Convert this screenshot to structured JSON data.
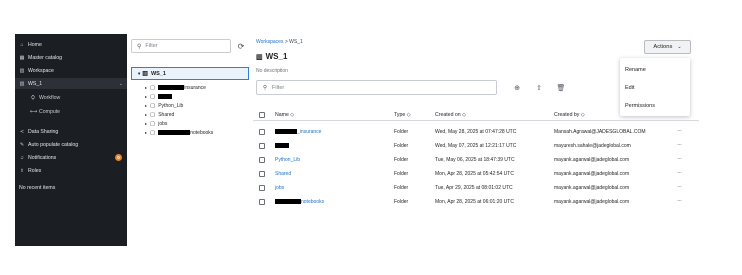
{
  "sidebar": {
    "items": [
      {
        "icon": "⌂",
        "icon_name": "home-icon",
        "label": "Home"
      },
      {
        "icon": "▦",
        "icon_name": "catalog-icon",
        "label": "Master catalog"
      },
      {
        "icon": "▥",
        "icon_name": "workspace-icon",
        "label": "Workspace"
      },
      {
        "icon": "▥",
        "icon_name": "workspace-icon",
        "label": "WS_1",
        "active": true
      },
      {
        "icon": "⛭",
        "icon_name": "workflow-icon",
        "label": "Workflow"
      },
      {
        "icon": "⟷",
        "icon_name": "compute-icon",
        "label": "Compute"
      },
      {
        "icon": "≺",
        "icon_name": "share-icon",
        "label": "Data Sharing"
      },
      {
        "icon": "✎",
        "icon_name": "auto-populate-icon",
        "label": "Auto populate catalog"
      },
      {
        "icon": "♫",
        "icon_name": "bell-icon",
        "label": "Notifications",
        "badge": "0"
      },
      {
        "icon": "♗",
        "icon_name": "roles-icon",
        "label": "Roles"
      }
    ],
    "recent_label": "No recent items"
  },
  "tree": {
    "search_placeholder": "Filter",
    "root_label": "WS_1",
    "children": [
      {
        "label": "insurance",
        "redacted": true
      },
      {
        "label": "",
        "redacted": true
      },
      {
        "label": "Python_Lib",
        "redacted": false
      },
      {
        "label": "Shared",
        "redacted": false
      },
      {
        "label": "jobs",
        "redacted": false
      },
      {
        "label": "notebooks",
        "redacted": true
      }
    ]
  },
  "main": {
    "breadcrumb": {
      "root": "Workspaces",
      "separator": ">",
      "current": "WS_1"
    },
    "title": "WS_1",
    "description": "No description",
    "actions_label": "Actions",
    "actions_menu": [
      "Rename",
      "Edit",
      "Permissions"
    ],
    "filter_placeholder": "Filter",
    "columns": {
      "name": "Name",
      "type": "Type",
      "created_on": "Created on",
      "created_by": "Created by"
    },
    "rows": [
      {
        "name": "_insurance",
        "redacted": true,
        "type": "Folder",
        "created_on": "Wed, May 28, 2025 at 07:47:28 UTC",
        "created_by": "Mansah.Agrawal@JADESGLOBAL.COM"
      },
      {
        "name": "",
        "redacted": true,
        "type": "Folder",
        "created_on": "Wed, May 07, 2025 at 12:21:17 UTC",
        "created_by": "mayuresh.sahale@jadeglobal.com"
      },
      {
        "name": "Python_Lib",
        "redacted": false,
        "type": "Folder",
        "created_on": "Tue, May 06, 2025 at 18:47:39 UTC",
        "created_by": "mayank.agarwal@jadeglobal.com"
      },
      {
        "name": "Shared",
        "redacted": false,
        "type": "Folder",
        "created_on": "Mon, Apr 28, 2025 at 05:42:54 UTC",
        "created_by": "mayank.agarwal@jadeglobal.com"
      },
      {
        "name": "jobs",
        "redacted": false,
        "type": "Folder",
        "created_on": "Tue, Apr 29, 2025 at 08:01:02 UTC",
        "created_by": "mayank.agarwal@jadeglobal.com"
      },
      {
        "name": "notebooks",
        "redacted": true,
        "type": "Folder",
        "created_on": "Mon, Apr 28, 2025 at 06:01:20 UTC",
        "created_by": "mayank.agarwal@jadeglobal.com"
      }
    ]
  },
  "colors": {
    "sidebar_bg": "#1b1e22",
    "link": "#2272c9",
    "selection_border": "#2f7fd9",
    "badge": "#e8832a"
  }
}
